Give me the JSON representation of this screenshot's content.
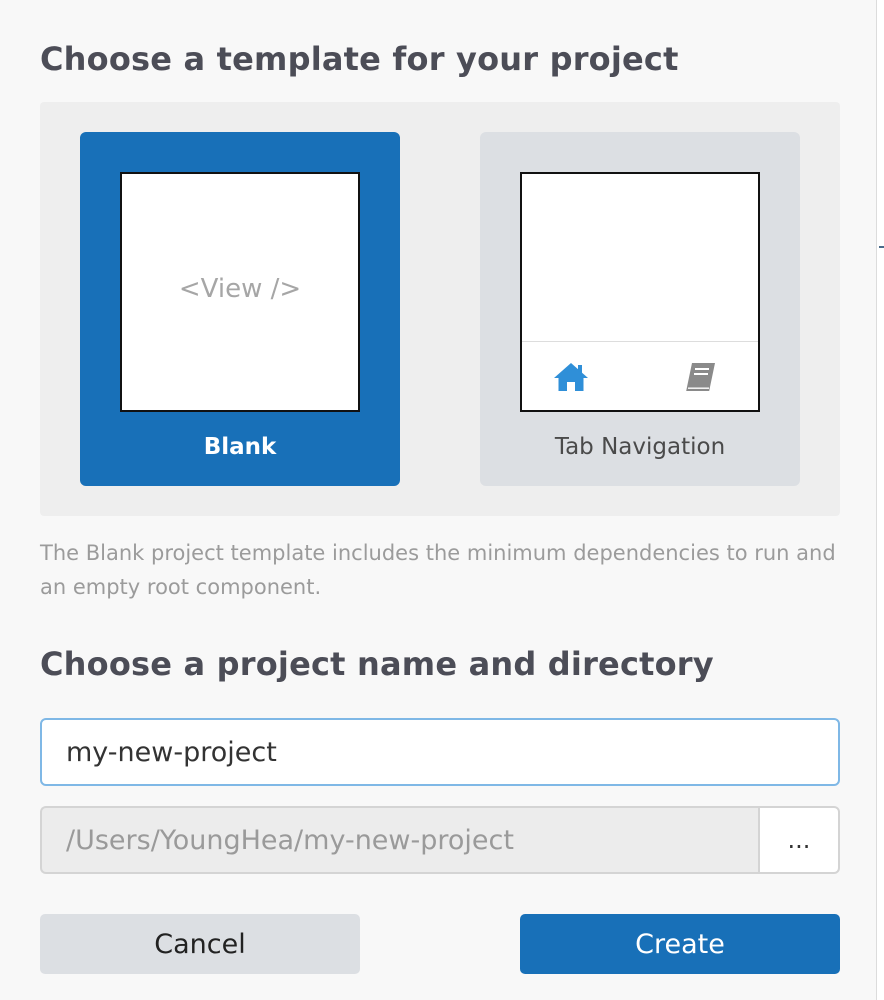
{
  "template_section": {
    "heading": "Choose a template for your project",
    "templates": [
      {
        "label": "Blank",
        "preview_text": "<View />",
        "selected": true
      },
      {
        "label": "Tab Navigation",
        "tab_icons": [
          "home-icon",
          "book-icon"
        ],
        "selected": false
      }
    ],
    "description": "The Blank project template includes the minimum dependencies to run and an empty root component."
  },
  "project_section": {
    "heading": "Choose a project name and directory",
    "name_value": "my-new-project",
    "directory_value": "/Users/YoungHea/my-new-project",
    "browse_label": "..."
  },
  "actions": {
    "cancel_label": "Cancel",
    "create_label": "Create"
  },
  "colors": {
    "accent": "#1870b8",
    "selected_card": "#1870b8",
    "unselected_card": "#dcdfe3",
    "heading_text": "#4c4d57",
    "muted_text": "#9b9b9b",
    "tab_icon_active": "#2f8fd8",
    "tab_icon_inactive": "#8a8a8a"
  }
}
